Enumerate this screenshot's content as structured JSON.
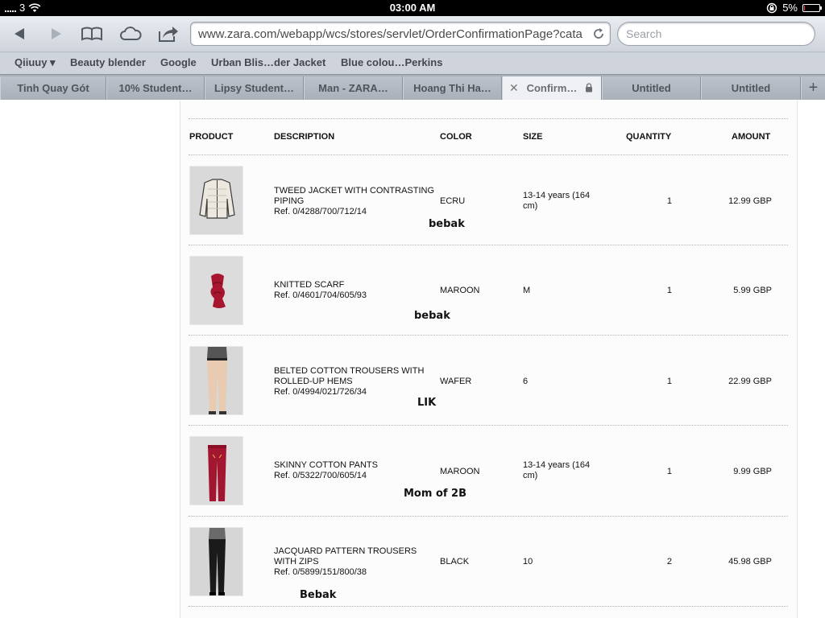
{
  "status_bar": {
    "carrier": "3",
    "time": "03:00 AM",
    "battery": "5%",
    "battery_level": 0.05
  },
  "browser": {
    "address": "www.zara.com/webapp/wcs/stores/servlet/OrderConfirmationPage?cata",
    "search_placeholder": "Search",
    "bookmarks": [
      "Qiiuuy ▾",
      "Beauty blender",
      "Google",
      "Urban Blis…der Jacket",
      "Blue colou…Perkins"
    ],
    "tabs": [
      {
        "label": "Tinh Quay Gót"
      },
      {
        "label": "10% Student…"
      },
      {
        "label": "Lipsy Student…"
      },
      {
        "label": "Man - ZARA…"
      },
      {
        "label": "Hoang Thi Ha…"
      },
      {
        "label": "Confirm…"
      },
      {
        "label": "Untitled"
      },
      {
        "label": "Untitled"
      }
    ],
    "new_tab_label": "+"
  },
  "table": {
    "headers": {
      "product": "PRODUCT",
      "description": "DESCRIPTION",
      "color": "COLOR",
      "size": "SIZE",
      "quantity": "QUANTITY",
      "amount": "AMOUNT"
    },
    "rows": [
      {
        "name": "TWEED JACKET WITH CONTRASTING PIPING",
        "ref": "Ref. 0/4288/700/712/14",
        "color": "ECRU",
        "size": "13-14 years (164 cm)",
        "quantity": "1",
        "amount": "12.99 GBP",
        "note": "bebak"
      },
      {
        "name": "KNITTED SCARF",
        "ref": "Ref. 0/4601/704/605/93",
        "color": "MAROON",
        "size": "M",
        "quantity": "1",
        "amount": "5.99 GBP",
        "note": "bebak"
      },
      {
        "name": "BELTED COTTON TROUSERS WITH ROLLED-UP HEMS",
        "ref": "Ref. 0/4994/021/726/34",
        "color": "WAFER",
        "size": "6",
        "quantity": "1",
        "amount": "22.99 GBP",
        "note": "LIK"
      },
      {
        "name": "SKINNY COTTON PANTS",
        "ref": "Ref. 0/5322/700/605/14",
        "color": "MAROON",
        "size": "13-14 years (164 cm)",
        "quantity": "1",
        "amount": "9.99 GBP",
        "note": "Mom of 2B"
      },
      {
        "name": "JACQUARD PATTERN TROUSERS WITH ZIPS",
        "ref": "Ref. 0/5899/151/800/38",
        "color": "BLACK",
        "size": "10",
        "quantity": "2",
        "amount": "45.98 GBP",
        "note": "Bebak"
      }
    ]
  }
}
